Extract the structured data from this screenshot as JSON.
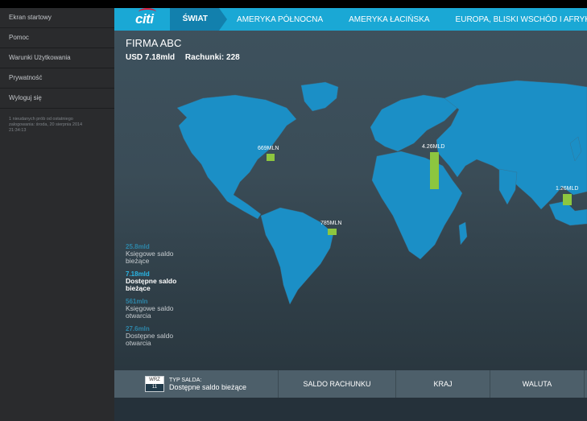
{
  "side_menu": {
    "items": [
      "Ekran startowy",
      "Pomoc",
      "Warunki Użytkowania",
      "Prywatność",
      "Wyloguj się"
    ],
    "login_info": [
      "1 nieudanych prób od ostatniego",
      "zalogowania: środa, 20 sierpnia 2014",
      "21:34:13"
    ]
  },
  "nav": {
    "logo": "citi",
    "active_tab": "ŚWIAT",
    "tabs": [
      "AMERYKA PÓŁNOCNA",
      "AMERYKA ŁACIŃSKA",
      "EUROPA, BLISKI WSCHÓD I AFRYKA"
    ]
  },
  "company": {
    "name": "FIRMA ABC",
    "total": "USD 7.18mld",
    "accounts": "Rachunki: 228"
  },
  "map_markers": [
    {
      "label": "669MLN",
      "value_mln": 669
    },
    {
      "label": "4.26MLD",
      "value_mln": 4260
    },
    {
      "label": "1.26MLD",
      "value_mln": 1260
    },
    {
      "label": "785MLN",
      "value_mln": 785
    }
  ],
  "legend": [
    {
      "value": "25.8mld",
      "label": "Księgowe saldo bieżące"
    },
    {
      "value": "7.18mld",
      "label": "Dostępne saldo bieżące"
    },
    {
      "value": "561mln",
      "label": "Księgowe saldo otwarcia"
    },
    {
      "value": "27.6mln",
      "label": "Dostępne saldo otwarcia"
    }
  ],
  "bottom": {
    "calendar_month": "WRZ",
    "calendar_day": "11",
    "balance_type_title": "TYP SALDA:",
    "balance_type_value": "Dostępne saldo bieżące",
    "col_account": "SALDO RACHUNKU",
    "col_country": "KRAJ",
    "col_currency": "WALUTA"
  },
  "colors": {
    "nav": "#1aa8d5",
    "active_tab": "#1280ad",
    "land": "#1b8fc6",
    "bar": "#8dc63f",
    "highlight": "#29b6e6"
  }
}
